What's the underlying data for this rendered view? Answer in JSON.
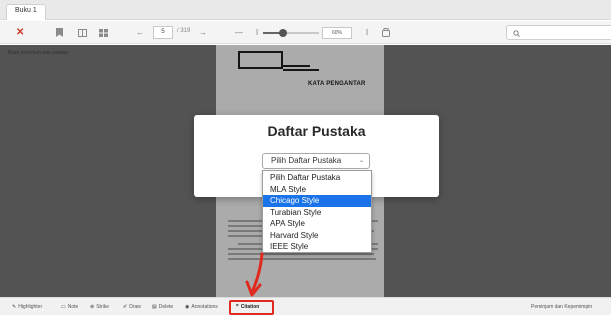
{
  "tabs": [
    {
      "label": "Buku 1"
    }
  ],
  "toolbar": {
    "close_icon": "close-icon",
    "page_current": "5",
    "page_total": "/ 319",
    "zoom": "60%",
    "search_icon": "search-icon",
    "zoom_level": 0.35
  },
  "reader": {
    "empty_notice": "Buku ini belum ada catatan",
    "page_heading": "KATA PENGANTAR"
  },
  "modal": {
    "title": "Daftar Pustaka",
    "select_value": "Pilih Daftar Pustaka",
    "options": [
      {
        "label": "Pilih Daftar Pustaka"
      },
      {
        "label": "MLA Style"
      },
      {
        "label": "Chicago Style"
      },
      {
        "label": "Turabian Style"
      },
      {
        "label": "APA Style"
      },
      {
        "label": "Harvard Style"
      },
      {
        "label": "IEEE Style"
      }
    ],
    "highlighted_option": "Chicago Style"
  },
  "bottombar": {
    "items": [
      {
        "icon": "pencil-icon",
        "label": "Highlighter"
      },
      {
        "icon": "note-icon",
        "label": "Note"
      },
      {
        "icon": "strike-icon",
        "label": "Strike"
      },
      {
        "icon": "draw-icon",
        "label": "Draw"
      },
      {
        "icon": "trash-icon",
        "label": "Delete"
      },
      {
        "icon": "eye-icon",
        "label": "Annotations"
      },
      {
        "icon": "quote-icon",
        "label": "Citation"
      }
    ],
    "right_label": "Peminjam dan Kepemimpin"
  },
  "colors": {
    "accent_red": "#e02a20",
    "selection_blue": "#1a73e8",
    "close_red": "#d0352b"
  }
}
